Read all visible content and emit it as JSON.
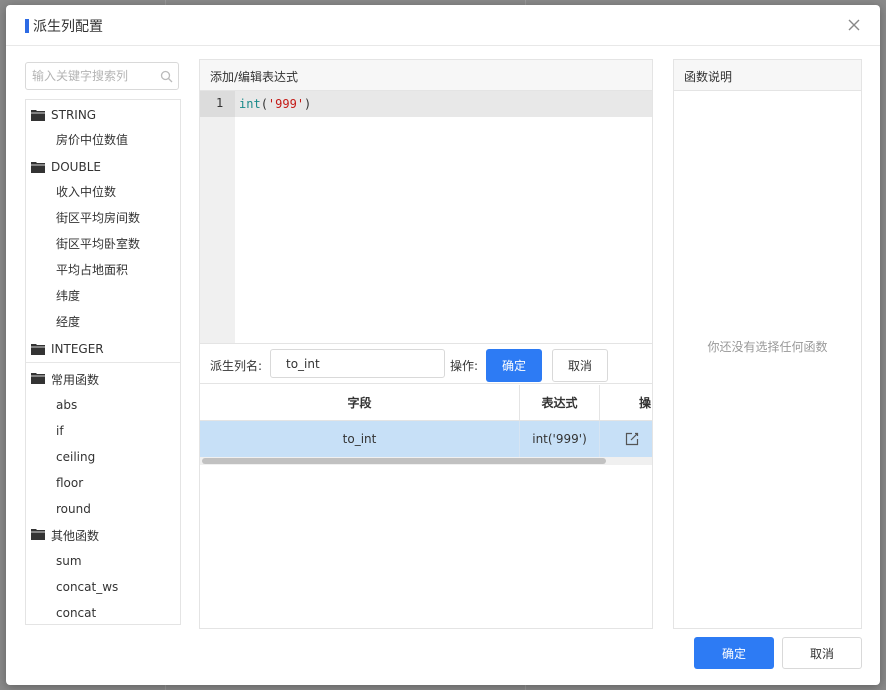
{
  "dialog": {
    "title": "派生列配置",
    "confirm_label": "确定",
    "cancel_label": "取消"
  },
  "left_panel": {
    "search_placeholder": "输入关键字搜索列",
    "tree": [
      {
        "folder": "STRING",
        "items": [
          "房价中位数值"
        ]
      },
      {
        "folder": "DOUBLE",
        "items": [
          "收入中位数",
          "街区平均房间数",
          "街区平均卧室数",
          "平均占地面积",
          "纬度",
          "经度"
        ]
      },
      {
        "folder": "INTEGER",
        "items": []
      },
      {
        "folder": "常用函数",
        "items": [
          "abs",
          "if",
          "ceiling",
          "floor",
          "round"
        ]
      },
      {
        "folder": "其他函数",
        "items": [
          "sum",
          "concat_ws",
          "concat"
        ]
      }
    ]
  },
  "editor_panel": {
    "title": "添加/编辑表达式",
    "line_number": "1",
    "code": {
      "fn": "int",
      "open": "(",
      "str": "'999'",
      "close": ")"
    },
    "name_label": "派生列名:",
    "name_value": "to_int",
    "op_label": "操作:",
    "ok_label": "确定",
    "cancel_label": "取消"
  },
  "table": {
    "headers": [
      "字段",
      "表达式",
      "操"
    ],
    "rows": [
      {
        "field": "to_int",
        "expression": "int('999')",
        "action_icon": "edit-icon"
      }
    ]
  },
  "right_panel": {
    "title": "函数说明",
    "empty_text": "你还没有选择任何函数"
  },
  "colors": {
    "accent": "#2d7bf4",
    "title_bar": "#2d6be4",
    "selected_row": "#c7e0f7"
  }
}
